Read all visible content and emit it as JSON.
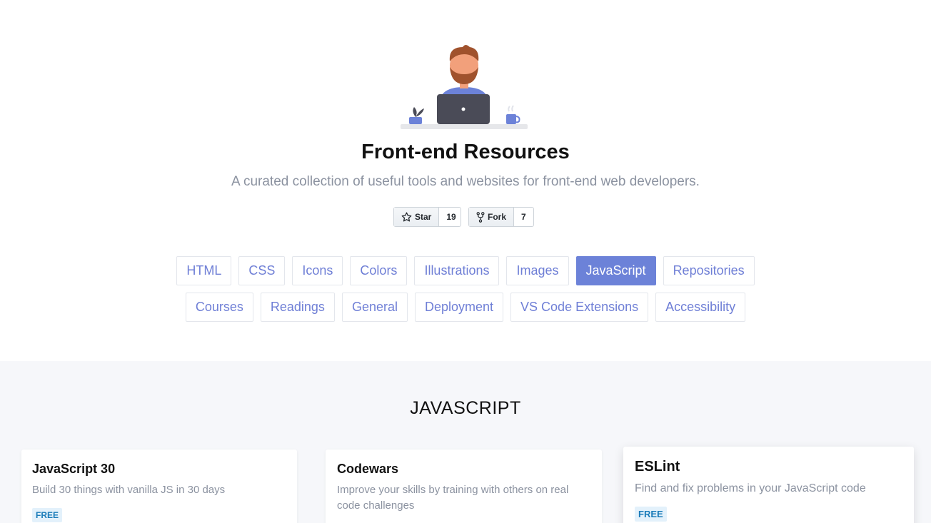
{
  "hero": {
    "title": "Front-end Resources",
    "subtitle": "A curated collection of useful tools and websites for front-end web developers."
  },
  "github": {
    "star_label": "Star",
    "star_count": "19",
    "fork_label": "Fork",
    "fork_count": "7"
  },
  "tags_row1": [
    "HTML",
    "CSS",
    "Icons",
    "Colors",
    "Illustrations",
    "Images",
    "JavaScript",
    "Repositories"
  ],
  "tags_row2": [
    "Courses",
    "Readings",
    "General",
    "Deployment",
    "VS Code Extensions",
    "Accessibility"
  ],
  "active_tag": "JavaScript",
  "section": {
    "title": "JAVASCRIPT"
  },
  "cards": [
    {
      "title": "JavaScript 30",
      "description": "Build 30 things with vanilla JS in 30 days",
      "badge": "FREE"
    },
    {
      "title": "Codewars",
      "description": "Improve your skills by training with others on real code challenges",
      "badge": ""
    },
    {
      "title": "ESLint",
      "description": "Find and fix problems in your JavaScript code",
      "badge": "FREE"
    }
  ],
  "colors": {
    "accent": "#6c82d8",
    "tag_text": "#6f7fd6",
    "badge_text": "#1a7bb9",
    "badge_bg": "#e3f1fb",
    "section_bg": "#f6f7fa"
  },
  "icons": {
    "illustration": "developer-at-laptop-illustration",
    "star": "star-icon",
    "fork": "fork-icon"
  }
}
